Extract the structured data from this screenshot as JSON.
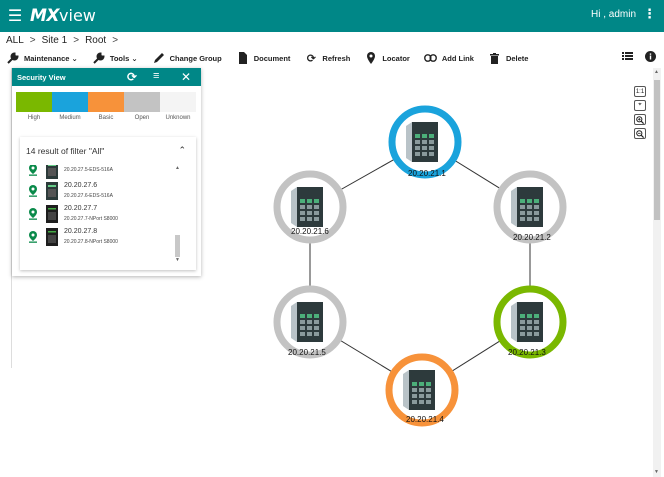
{
  "app": {
    "logo_a": "MX",
    "logo_b": "view",
    "user_greeting": "Hi , admin"
  },
  "breadcrumb": [
    "ALL",
    "Site 1",
    "Root"
  ],
  "toolbar": {
    "maintenance": "Maintenance",
    "tools": "Tools",
    "change_group": "Change Group",
    "document": "Document",
    "refresh": "Refresh",
    "locator": "Locator",
    "add_link": "Add Link",
    "delete": "Delete"
  },
  "security_view": {
    "title": "Security View",
    "legend": [
      {
        "label": "High",
        "color": "#7ab800"
      },
      {
        "label": "Medium",
        "color": "#1aa3dc"
      },
      {
        "label": "Basic",
        "color": "#f7923a"
      },
      {
        "label": "Open",
        "color": "#c3c3c3"
      },
      {
        "label": "Unknown",
        "color": "#f4f4f4"
      }
    ],
    "results_title": "14 result of filter \"All\"",
    "devices": [
      {
        "ip": "",
        "sub": "20.20.27.5-EDS-516A"
      },
      {
        "ip": "20.20.27.6",
        "sub": "20.20.27.6-EDS-516A"
      },
      {
        "ip": "20.20.27.7",
        "sub": "20.20.27.7-NPort S8000"
      },
      {
        "ip": "20.20.27.8",
        "sub": "20.20.27.8-NPort S8000"
      }
    ]
  },
  "zoom": {
    "one_to_one": "1:1"
  },
  "topology": {
    "nodes": [
      {
        "id": "n1",
        "label": "20.20.21.1",
        "security": "Medium",
        "ring_color": "#1aa3dc"
      },
      {
        "id": "n2",
        "label": "20.20.21.2",
        "security": "Open",
        "ring_color": "#c3c3c3"
      },
      {
        "id": "n3",
        "label": "20.20.21.3",
        "security": "High",
        "ring_color": "#7ab800"
      },
      {
        "id": "n4",
        "label": "20.20.21.4",
        "security": "Basic",
        "ring_color": "#f7923a"
      },
      {
        "id": "n5",
        "label": "20.20.21.5",
        "security": "Open",
        "ring_color": "#c3c3c3"
      },
      {
        "id": "n6",
        "label": "20.20.21.6",
        "security": "Open",
        "ring_color": "#c3c3c3"
      }
    ],
    "links": [
      [
        "n1",
        "n2"
      ],
      [
        "n2",
        "n3"
      ],
      [
        "n3",
        "n4"
      ],
      [
        "n4",
        "n5"
      ],
      [
        "n5",
        "n6"
      ],
      [
        "n6",
        "n1"
      ]
    ]
  },
  "colors": {
    "brand": "#008787",
    "panel_header": "#008787"
  }
}
